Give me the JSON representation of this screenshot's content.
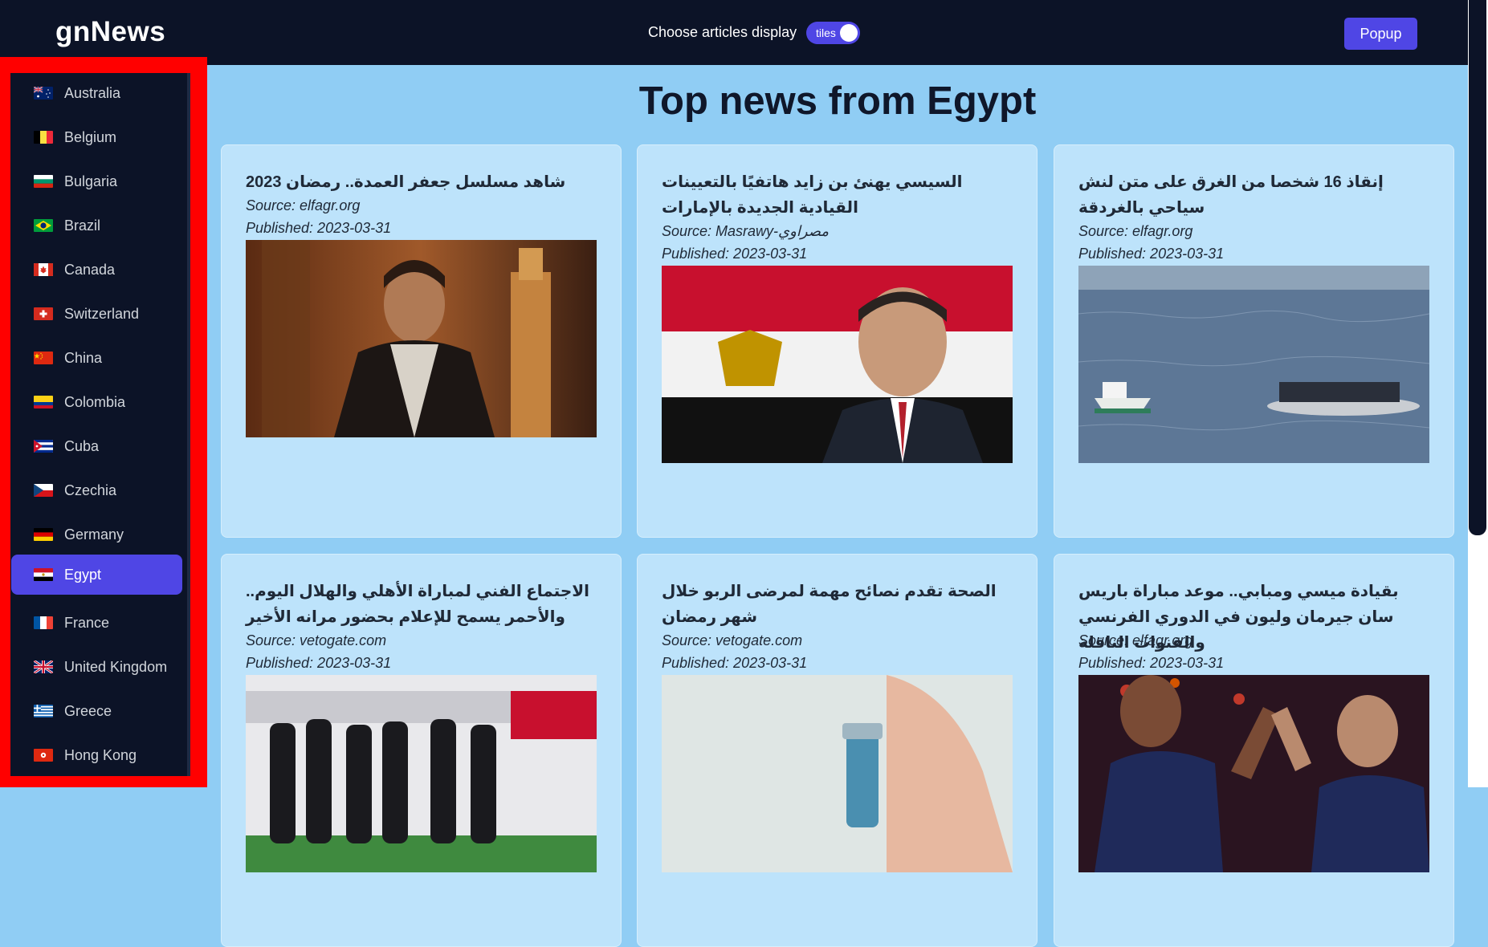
{
  "header": {
    "brand": "gnNews",
    "display_label": "Choose articles display",
    "toggle_label": "tiles",
    "popup_button": "Popup"
  },
  "sidebar": {
    "active": "Egypt",
    "countries": [
      {
        "label": "Australia",
        "flag": "australia-flag-icon"
      },
      {
        "label": "Belgium",
        "flag": "belgium-flag-icon"
      },
      {
        "label": "Bulgaria",
        "flag": "bulgaria-flag-icon"
      },
      {
        "label": "Brazil",
        "flag": "brazil-flag-icon"
      },
      {
        "label": "Canada",
        "flag": "canada-flag-icon"
      },
      {
        "label": "Switzerland",
        "flag": "switzerland-flag-icon"
      },
      {
        "label": "China",
        "flag": "china-flag-icon"
      },
      {
        "label": "Colombia",
        "flag": "colombia-flag-icon"
      },
      {
        "label": "Cuba",
        "flag": "cuba-flag-icon"
      },
      {
        "label": "Czechia",
        "flag": "czechia-flag-icon"
      },
      {
        "label": "Germany",
        "flag": "germany-flag-icon"
      },
      {
        "label": "Egypt",
        "flag": "egypt-flag-icon"
      },
      {
        "label": "France",
        "flag": "france-flag-icon"
      },
      {
        "label": "United Kingdom",
        "flag": "united-kingdom-flag-icon"
      },
      {
        "label": "Greece",
        "flag": "greece-flag-icon"
      },
      {
        "label": "Hong Kong",
        "flag": "hong-kong-flag-icon"
      }
    ]
  },
  "main": {
    "title": "Top news from Egypt",
    "articles": [
      {
        "title": "شاهد مسلسل جعفر العمدة.. رمضان 2023",
        "source": "Source: elfagr.org",
        "published": "Published: 2023-03-31",
        "image": "actor-in-scarf-photo"
      },
      {
        "title": "السيسي يهنئ بن زايد هاتفيًا بالتعيينات القيادية الجديدة بالإمارات",
        "source": "Source: Masrawy-مصراوي",
        "published": "Published: 2023-03-31",
        "image": "president-with-flag-photo"
      },
      {
        "title": "إنقاذ 16 شخصا من الغرق على متن لنش سياحي بالغردقة",
        "source": "Source: elfagr.org",
        "published": "Published: 2023-03-31",
        "image": "boat-rescue-at-sea-photo"
      },
      {
        "title": "الاجتماع الفني لمباراة الأهلي والهلال اليوم.. والأحمر يسمح للإعلام بحضور مرانه الأخير",
        "source": "Source: vetogate.com",
        "published": "Published: 2023-03-31",
        "image": "football-team-training-photo"
      },
      {
        "title": "الصحة تقدم نصائح مهمة لمرضى الربو خلال شهر رمضان",
        "source": "Source: vetogate.com",
        "published": "Published: 2023-03-31",
        "image": "man-with-inhaler-photo"
      },
      {
        "title": "بقيادة ميسي ومبابي.. موعد مباراة باريس سان جيرمان وليون في الدوري الفرنسي والقنوات الناقلة",
        "source": "Source: elfagr.org",
        "published": "Published: 2023-03-31",
        "image": "players-high-five-photo"
      }
    ]
  },
  "colors": {
    "header_bg": "#0c1327",
    "accent": "#4f46e5",
    "page_bg": "#90cdf4",
    "card_bg": "#bde3fb",
    "sidebar_highlight": "#ff0000"
  }
}
